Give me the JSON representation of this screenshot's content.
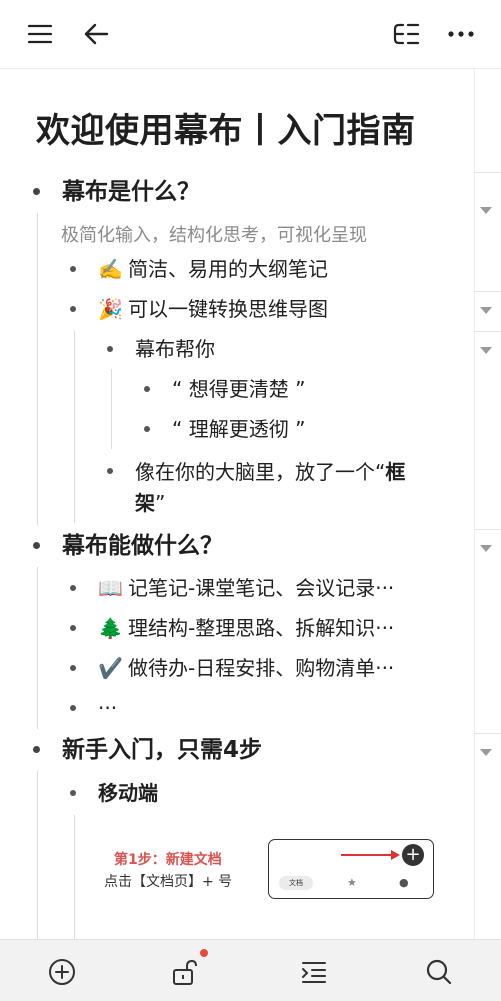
{
  "topbar": {
    "icons": [
      "menu-icon",
      "back-arrow-icon",
      "outline-mindmap-icon",
      "more-icon"
    ]
  },
  "doc": {
    "title": "欢迎使用幕布丨入门指南",
    "s1": {
      "heading": "幕布是什么？",
      "note": "极简化输入，结构化思考，可视化呈现",
      "i1": {
        "emoji": "✍️",
        "text": "简洁、易用的大纲笔记"
      },
      "i2": {
        "emoji": "🎉",
        "text": "可以一键转换思维导图"
      },
      "i2a": "幕布帮你",
      "i2a1": "“ 想得更清楚 ”",
      "i2a2": "“ 理解更透彻 ”",
      "i2b_line1": "像在你的大脑里，放了一个“",
      "i2b_bold1": "框",
      "i2b_bold2": "架",
      "i2b_end": "”"
    },
    "s2": {
      "heading": "幕布能做什么？",
      "i1": {
        "emoji": "📖",
        "text": "记笔记-课堂笔记、会议记录···"
      },
      "i2": {
        "emoji": "🌲",
        "text": "理结构-整理思路、拆解知识···"
      },
      "i3": {
        "emoji": "✔️",
        "text": "做待办-日程安排、购物清单···"
      },
      "i4": "···"
    },
    "s3": {
      "heading_pre": "新手入门，只需",
      "heading_num": "4",
      "heading_post": "步",
      "i1": "移动端",
      "step_title": "第1步：新建文档",
      "step_desc": "点击【文档页】+ 号",
      "card_tab": "文档"
    }
  },
  "bottombar": {
    "icons": [
      "add-circle-icon",
      "unlock-icon",
      "indent-icon",
      "search-icon"
    ]
  },
  "colors": {
    "accent_red": "#e8493b",
    "step_red": "#d9534f"
  }
}
